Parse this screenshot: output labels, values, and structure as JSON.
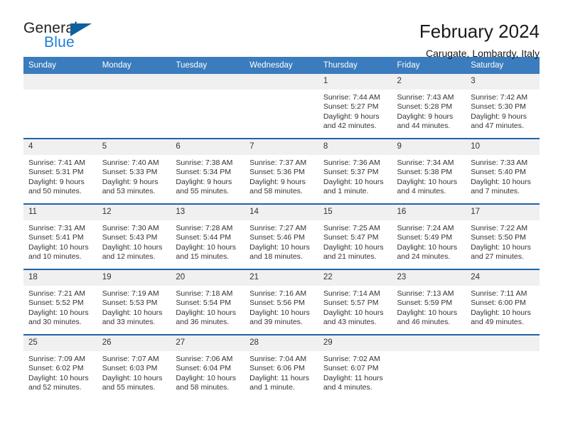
{
  "brand": {
    "name_top": "General",
    "name_bottom": "Blue",
    "triangle_color": "#10609e",
    "blue_color": "#1c7fd4"
  },
  "header": {
    "title": "February 2024",
    "subtitle": "Carugate, Lombardy, Italy",
    "header_bg": "#3a7cbe",
    "row_divider": "#1d64a8",
    "daynum_bg": "#f0f0f0"
  },
  "weekdays": [
    "Sunday",
    "Monday",
    "Tuesday",
    "Wednesday",
    "Thursday",
    "Friday",
    "Saturday"
  ],
  "weeks": [
    [
      {
        "day": "",
        "lines": []
      },
      {
        "day": "",
        "lines": []
      },
      {
        "day": "",
        "lines": []
      },
      {
        "day": "",
        "lines": []
      },
      {
        "day": "1",
        "lines": [
          "Sunrise: 7:44 AM",
          "Sunset: 5:27 PM",
          "Daylight: 9 hours",
          "and 42 minutes."
        ]
      },
      {
        "day": "2",
        "lines": [
          "Sunrise: 7:43 AM",
          "Sunset: 5:28 PM",
          "Daylight: 9 hours",
          "and 44 minutes."
        ]
      },
      {
        "day": "3",
        "lines": [
          "Sunrise: 7:42 AM",
          "Sunset: 5:30 PM",
          "Daylight: 9 hours",
          "and 47 minutes."
        ]
      }
    ],
    [
      {
        "day": "4",
        "lines": [
          "Sunrise: 7:41 AM",
          "Sunset: 5:31 PM",
          "Daylight: 9 hours",
          "and 50 minutes."
        ]
      },
      {
        "day": "5",
        "lines": [
          "Sunrise: 7:40 AM",
          "Sunset: 5:33 PM",
          "Daylight: 9 hours",
          "and 53 minutes."
        ]
      },
      {
        "day": "6",
        "lines": [
          "Sunrise: 7:38 AM",
          "Sunset: 5:34 PM",
          "Daylight: 9 hours",
          "and 55 minutes."
        ]
      },
      {
        "day": "7",
        "lines": [
          "Sunrise: 7:37 AM",
          "Sunset: 5:36 PM",
          "Daylight: 9 hours",
          "and 58 minutes."
        ]
      },
      {
        "day": "8",
        "lines": [
          "Sunrise: 7:36 AM",
          "Sunset: 5:37 PM",
          "Daylight: 10 hours",
          "and 1 minute."
        ]
      },
      {
        "day": "9",
        "lines": [
          "Sunrise: 7:34 AM",
          "Sunset: 5:38 PM",
          "Daylight: 10 hours",
          "and 4 minutes."
        ]
      },
      {
        "day": "10",
        "lines": [
          "Sunrise: 7:33 AM",
          "Sunset: 5:40 PM",
          "Daylight: 10 hours",
          "and 7 minutes."
        ]
      }
    ],
    [
      {
        "day": "11",
        "lines": [
          "Sunrise: 7:31 AM",
          "Sunset: 5:41 PM",
          "Daylight: 10 hours",
          "and 10 minutes."
        ]
      },
      {
        "day": "12",
        "lines": [
          "Sunrise: 7:30 AM",
          "Sunset: 5:43 PM",
          "Daylight: 10 hours",
          "and 12 minutes."
        ]
      },
      {
        "day": "13",
        "lines": [
          "Sunrise: 7:28 AM",
          "Sunset: 5:44 PM",
          "Daylight: 10 hours",
          "and 15 minutes."
        ]
      },
      {
        "day": "14",
        "lines": [
          "Sunrise: 7:27 AM",
          "Sunset: 5:46 PM",
          "Daylight: 10 hours",
          "and 18 minutes."
        ]
      },
      {
        "day": "15",
        "lines": [
          "Sunrise: 7:25 AM",
          "Sunset: 5:47 PM",
          "Daylight: 10 hours",
          "and 21 minutes."
        ]
      },
      {
        "day": "16",
        "lines": [
          "Sunrise: 7:24 AM",
          "Sunset: 5:49 PM",
          "Daylight: 10 hours",
          "and 24 minutes."
        ]
      },
      {
        "day": "17",
        "lines": [
          "Sunrise: 7:22 AM",
          "Sunset: 5:50 PM",
          "Daylight: 10 hours",
          "and 27 minutes."
        ]
      }
    ],
    [
      {
        "day": "18",
        "lines": [
          "Sunrise: 7:21 AM",
          "Sunset: 5:52 PM",
          "Daylight: 10 hours",
          "and 30 minutes."
        ]
      },
      {
        "day": "19",
        "lines": [
          "Sunrise: 7:19 AM",
          "Sunset: 5:53 PM",
          "Daylight: 10 hours",
          "and 33 minutes."
        ]
      },
      {
        "day": "20",
        "lines": [
          "Sunrise: 7:18 AM",
          "Sunset: 5:54 PM",
          "Daylight: 10 hours",
          "and 36 minutes."
        ]
      },
      {
        "day": "21",
        "lines": [
          "Sunrise: 7:16 AM",
          "Sunset: 5:56 PM",
          "Daylight: 10 hours",
          "and 39 minutes."
        ]
      },
      {
        "day": "22",
        "lines": [
          "Sunrise: 7:14 AM",
          "Sunset: 5:57 PM",
          "Daylight: 10 hours",
          "and 43 minutes."
        ]
      },
      {
        "day": "23",
        "lines": [
          "Sunrise: 7:13 AM",
          "Sunset: 5:59 PM",
          "Daylight: 10 hours",
          "and 46 minutes."
        ]
      },
      {
        "day": "24",
        "lines": [
          "Sunrise: 7:11 AM",
          "Sunset: 6:00 PM",
          "Daylight: 10 hours",
          "and 49 minutes."
        ]
      }
    ],
    [
      {
        "day": "25",
        "lines": [
          "Sunrise: 7:09 AM",
          "Sunset: 6:02 PM",
          "Daylight: 10 hours",
          "and 52 minutes."
        ]
      },
      {
        "day": "26",
        "lines": [
          "Sunrise: 7:07 AM",
          "Sunset: 6:03 PM",
          "Daylight: 10 hours",
          "and 55 minutes."
        ]
      },
      {
        "day": "27",
        "lines": [
          "Sunrise: 7:06 AM",
          "Sunset: 6:04 PM",
          "Daylight: 10 hours",
          "and 58 minutes."
        ]
      },
      {
        "day": "28",
        "lines": [
          "Sunrise: 7:04 AM",
          "Sunset: 6:06 PM",
          "Daylight: 11 hours",
          "and 1 minute."
        ]
      },
      {
        "day": "29",
        "lines": [
          "Sunrise: 7:02 AM",
          "Sunset: 6:07 PM",
          "Daylight: 11 hours",
          "and 4 minutes."
        ]
      },
      {
        "day": "",
        "lines": []
      },
      {
        "day": "",
        "lines": []
      }
    ]
  ]
}
